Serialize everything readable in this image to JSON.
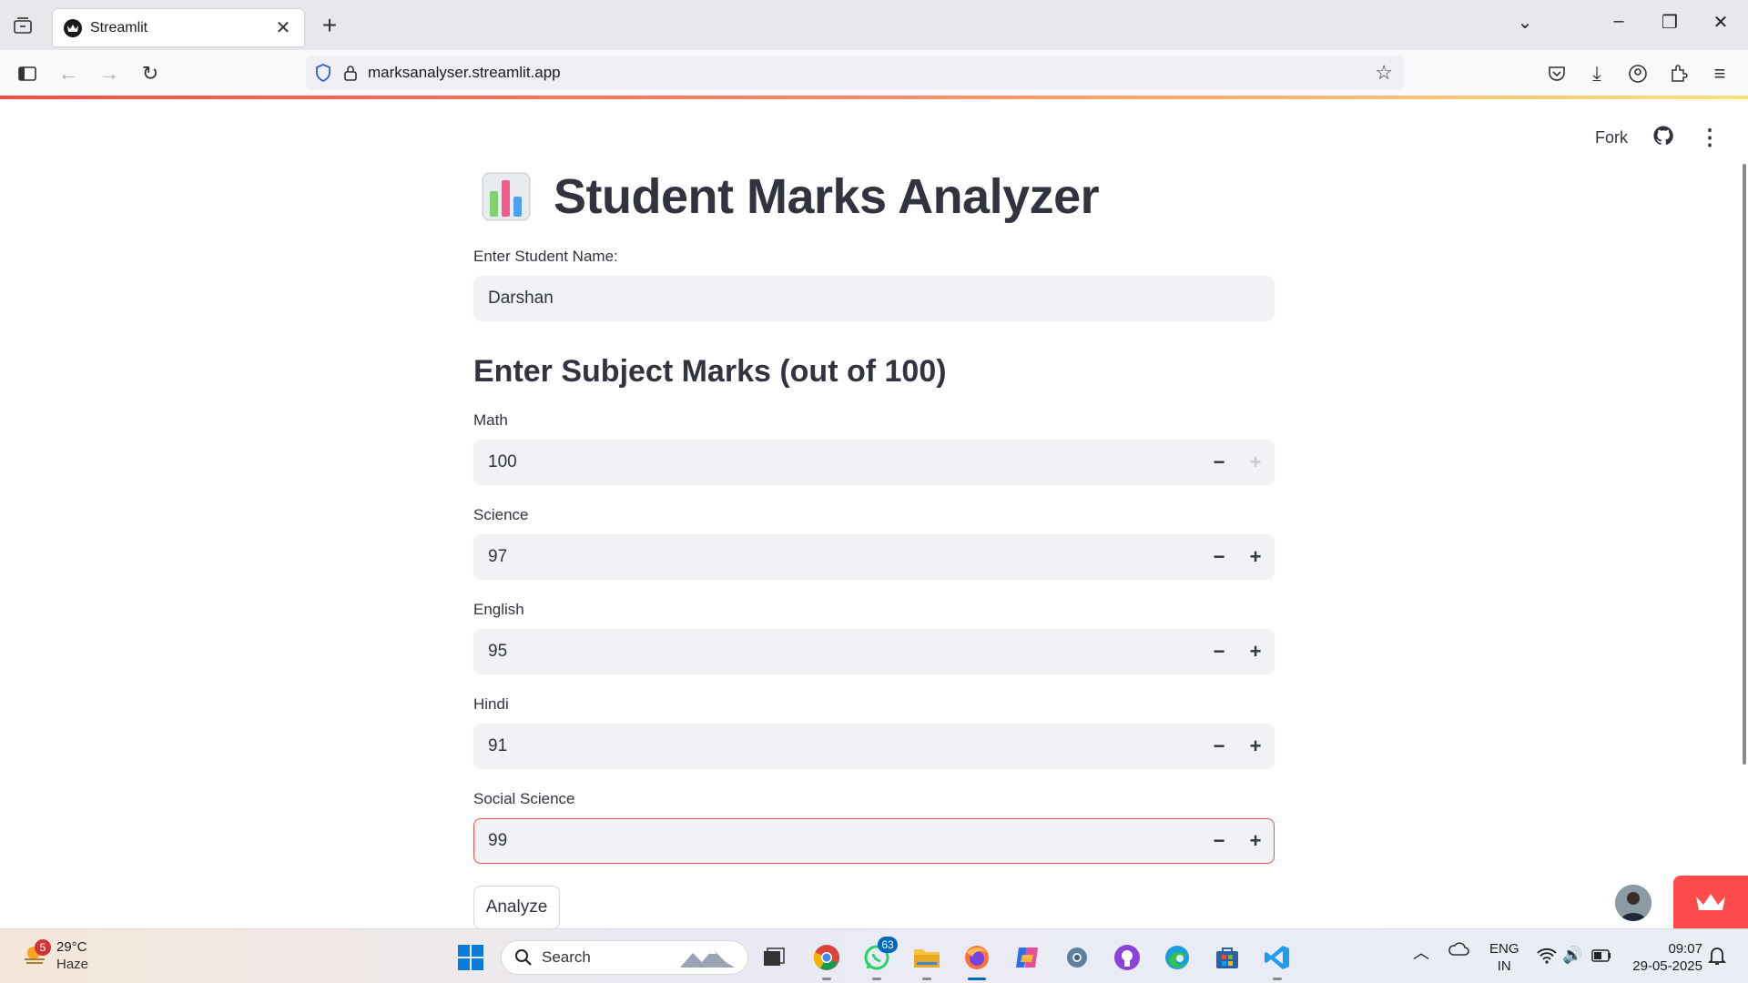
{
  "browser": {
    "tab_title": "Streamlit",
    "url": "marksanalyser.streamlit.app",
    "accent_gradient": [
      "#ff4b4b",
      "#ffe27a"
    ]
  },
  "app": {
    "header": {
      "fork_label": "Fork"
    },
    "title": "Student Marks Analyzer",
    "title_icon": "bar-chart-emoji",
    "name_field": {
      "label": "Enter Student Name:",
      "value": "Darshan"
    },
    "marks_heading": "Enter Subject Marks (out of 100)",
    "subjects": [
      {
        "label": "Math",
        "value": "100"
      },
      {
        "label": "Science",
        "value": "97"
      },
      {
        "label": "English",
        "value": "95"
      },
      {
        "label": "Hindi",
        "value": "91"
      },
      {
        "label": "Social Science",
        "value": "99"
      }
    ],
    "step_minus": "−",
    "step_plus": "+",
    "analyze_label": "Analyze",
    "accent_color": "#ff4b4b"
  },
  "taskbar": {
    "weather": {
      "badge": "5",
      "temp": "29°C",
      "condition": "Haze"
    },
    "search_label": "Search",
    "whatsapp_badge": "63",
    "language": {
      "line1": "ENG",
      "line2": "IN"
    },
    "time": "09:07",
    "date": "29-05-2025"
  }
}
